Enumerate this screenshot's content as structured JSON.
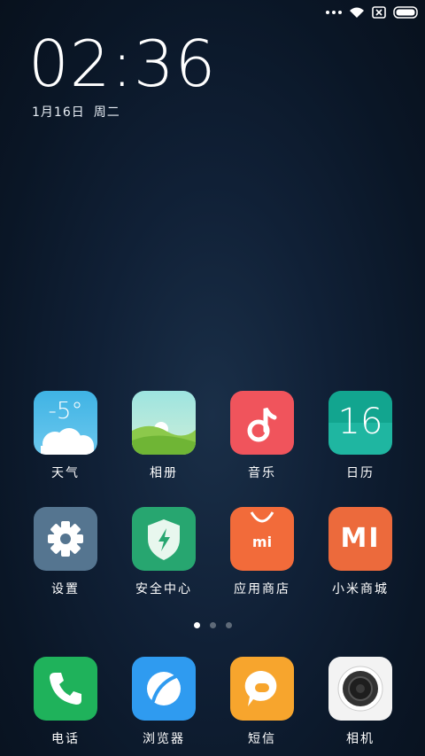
{
  "status": {
    "icons": [
      "more-dots-icon",
      "wifi-icon",
      "no-sim-icon",
      "battery-icon"
    ]
  },
  "clock": {
    "time": "02:36",
    "date": "1月16日",
    "weekday": "周二"
  },
  "apps": [
    {
      "label": "天气",
      "icon": "weather-icon",
      "temp": "-5°",
      "color": "#4fb8e6"
    },
    {
      "label": "相册",
      "icon": "gallery-icon",
      "color": "#8fd0b0"
    },
    {
      "label": "音乐",
      "icon": "music-icon",
      "color": "#f0545c"
    },
    {
      "label": "日历",
      "icon": "calendar-icon",
      "day": "16",
      "color": "#18a898"
    },
    {
      "label": "设置",
      "icon": "gear-icon",
      "color": "#5a7791"
    },
    {
      "label": "安全中心",
      "icon": "shield-icon",
      "color": "#27a670"
    },
    {
      "label": "应用商店",
      "icon": "store-bag-icon",
      "glyph": "mi",
      "color": "#f26b3a"
    },
    {
      "label": "小米商城",
      "icon": "mi-logo-icon",
      "glyph": "MI",
      "color": "#ec6a3c"
    }
  ],
  "dock": [
    {
      "label": "电话",
      "icon": "phone-icon",
      "color": "#1fb25b"
    },
    {
      "label": "浏览器",
      "icon": "browser-icon",
      "color": "#2f9bf0"
    },
    {
      "label": "短信",
      "icon": "message-icon",
      "color": "#f7a52d"
    },
    {
      "label": "相机",
      "icon": "camera-icon",
      "color": "#f4f4f4"
    }
  ],
  "pager": {
    "pages": 3,
    "active": 1
  }
}
